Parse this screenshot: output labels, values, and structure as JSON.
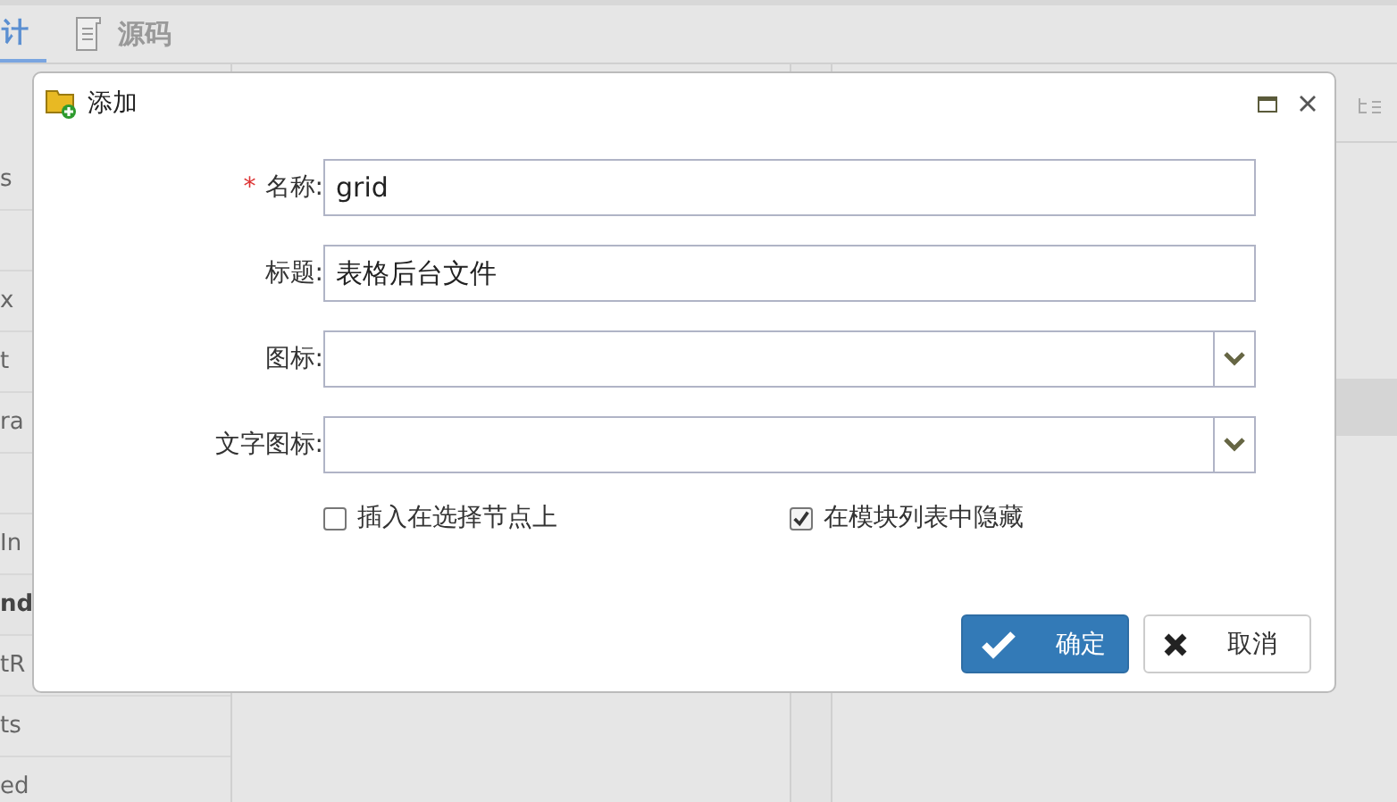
{
  "tabs": [
    {
      "label": "计",
      "selected": true
    },
    {
      "label": "源码",
      "selected": false
    }
  ],
  "left_list": [
    {
      "kind": "text",
      "text": "s",
      "bold": false
    },
    {
      "kind": "blank"
    },
    {
      "kind": "text",
      "text": "x",
      "bold": false
    },
    {
      "kind": "text",
      "text": "t",
      "bold": false
    },
    {
      "kind": "text",
      "text": "ra",
      "bold": false
    },
    {
      "kind": "blank"
    },
    {
      "kind": "text",
      "text": "In",
      "bold": false
    },
    {
      "kind": "text",
      "text": "nd",
      "bold": true
    },
    {
      "kind": "text",
      "text": "tR",
      "bold": false
    },
    {
      "kind": "text",
      "text": "ts",
      "bold": false
    },
    {
      "kind": "text",
      "text": "ed",
      "bold": false
    }
  ],
  "dialog": {
    "title": "添加",
    "fields": [
      {
        "required_mark": "*",
        "label": "名称:",
        "kind": "text",
        "value": "grid"
      },
      {
        "label": "标题:",
        "kind": "text",
        "value": "表格后台文件"
      },
      {
        "label": "图标:",
        "kind": "combo"
      },
      {
        "label": "文字图标:",
        "kind": "combo"
      }
    ],
    "checkboxes": [
      {
        "label": "插入在选择节点上",
        "checked": false
      },
      {
        "label": "在模块列表中隐藏",
        "checked": true
      }
    ],
    "ok_button": "确定",
    "cancel_button": "取消"
  }
}
